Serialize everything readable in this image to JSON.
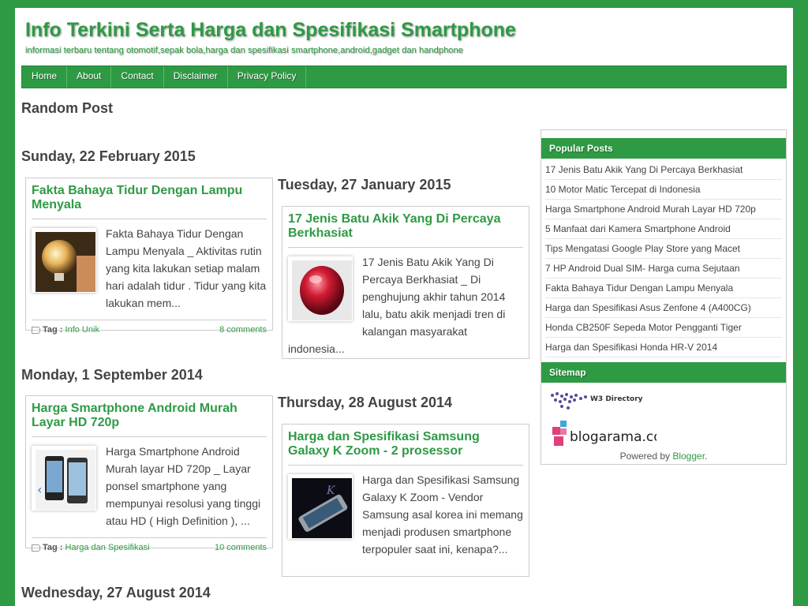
{
  "header": {
    "title": "Info Terkini Serta Harga dan Spesifikasi Smartphone",
    "description": "informasi terbaru tentang otomotif,sepak bola,harga dan spesifikasi smartphone,android,gadget dan handphone"
  },
  "nav": {
    "items": [
      "Home",
      "About",
      "Contact",
      "Disclaimer",
      "Privacy Policy"
    ]
  },
  "random_post_label": "Random Post",
  "left_column": {
    "dates": [
      "Sunday, 22 February 2015",
      "Monday, 1 September 2014",
      "Wednesday, 27 August 2014"
    ],
    "posts": [
      {
        "title": "Fakta Bahaya Tidur Dengan Lampu Menyala",
        "excerpt": "Fakta Bahaya Tidur Dengan Lampu Menyala _ Aktivitas rutin yang kita lakukan setiap malam hari adalah tidur . Tidur yang kita lakukan mem...",
        "tag_label": "Tag :",
        "tag": "Info Unik",
        "comments": "8 comments"
      },
      {
        "title": "Harga Smartphone Android Murah Layar HD 720p",
        "excerpt": "Harga Smartphone Android Murah layar HD 720p   _   Layar ponsel smartphone yang mempunyai resolusi yang tinggi atau HD ( High Definition ), ...",
        "tag_label": "Tag :",
        "tag": "Harga dan Spesifikasi",
        "comments": "10 comments"
      }
    ]
  },
  "right_column": {
    "dates": [
      "Tuesday, 27 January 2015",
      "Thursday, 28 August 2014"
    ],
    "posts": [
      {
        "title": "17 Jenis Batu Akik Yang Di Percaya Berkhasiat",
        "excerpt": "17 Jenis Batu Akik Yang Di Percaya Berkhasiat _ Di penghujung akhir tahun 2014 lalu, batu akik menjadi tren di kalangan masyarakat indonesia..."
      },
      {
        "title": "Harga dan Spesifikasi Samsung Galaxy K Zoom - 2 prosessor",
        "excerpt": "Harga dan Spesifikasi Samsung Galaxy K Zoom - Vendor Samsung asal korea ini memang menjadi produsen smartphone terpopuler saat ini, kenapa?..."
      }
    ]
  },
  "sidebar": {
    "popular_title": "Popular Posts",
    "popular_posts": [
      "17 Jenis Batu Akik Yang Di Percaya Berkhasiat",
      "10 Motor Matic Tercepat di Indonesia",
      "Harga Smartphone Android Murah Layar HD 720p",
      "5 Manfaat dari Kamera Smartphone Android",
      "Tips Mengatasi Google Play Store yang Macet",
      "7 HP Android Dual SIM- Harga cuma Sejutaan",
      "Fakta Bahaya Tidur Dengan Lampu Menyala",
      "Harga dan Spesifikasi Asus Zenfone 4 (A400CG)",
      "Honda CB250F Sepeda Motor Pengganti Tiger",
      "Harga dan Spesifikasi Honda HR-V 2014"
    ],
    "sitemap_title": "Sitemap",
    "w3_label": "W3 Directory",
    "blogarama_label": "blogarama.com",
    "powered_prefix": "Powered by ",
    "powered_link": "Blogger",
    "powered_suffix": "."
  },
  "colors": {
    "accent": "#2e9a44",
    "text": "#444444"
  }
}
